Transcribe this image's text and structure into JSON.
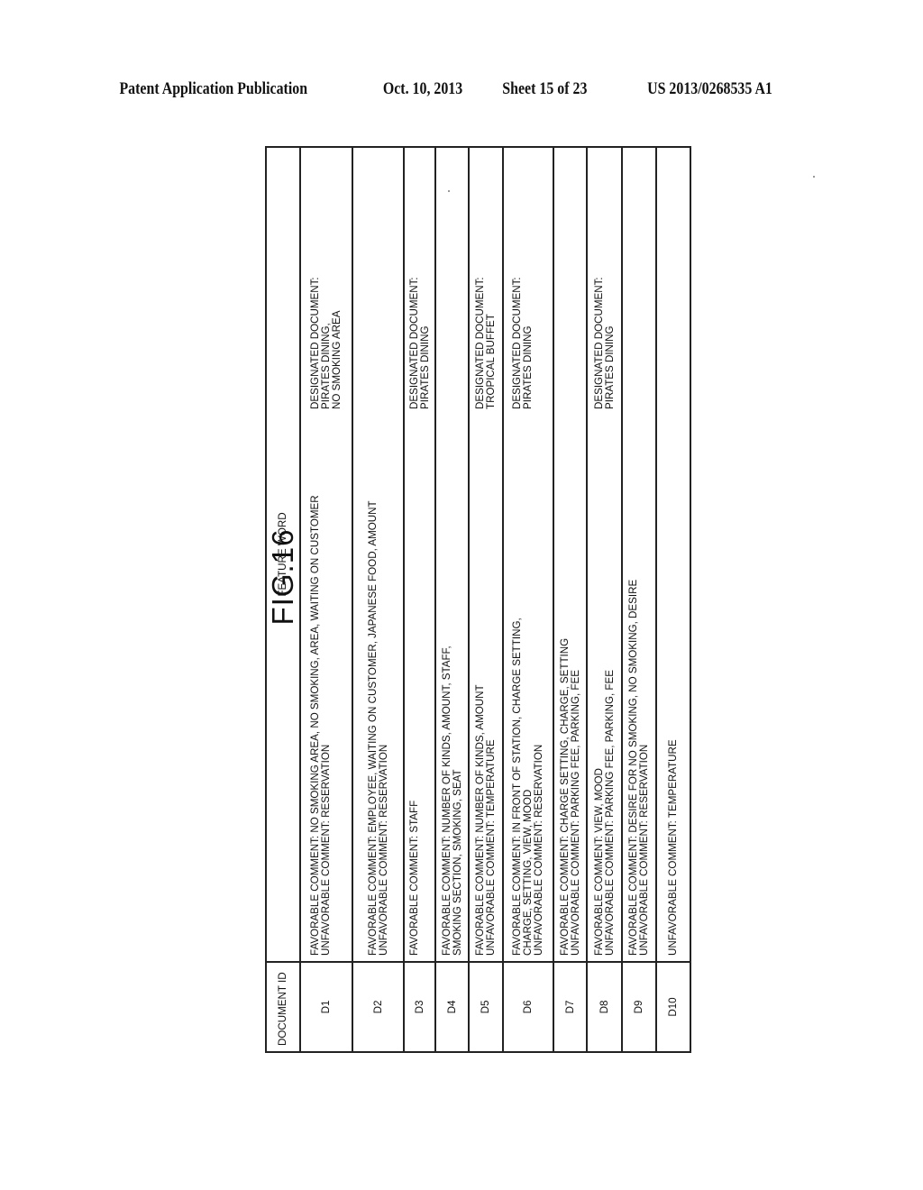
{
  "header": {
    "publication_type": "Patent Application Publication",
    "date": "Oct. 10, 2013",
    "sheet": "Sheet 15 of 23",
    "number": "US 2013/0268535 A1"
  },
  "figure": {
    "label": "FIG.16",
    "orientation": "rotated 90 degrees counter-clockwise"
  },
  "table": {
    "columns": [
      "DOCUMENT ID",
      "FEATURE WORD"
    ],
    "rows": [
      {
        "id": "D1",
        "feature_lines": [
          "FAVORABLE COMMENT: NO SMOKING AREA, NO SMOKING, AREA, WAITING ON CUSTOMER",
          "UNFAVORABLE COMMENT: RESERVATION"
        ],
        "designated_lines": [
          "DESIGNATED DOCUMENT:",
          "PIRATES DINING,",
          "NO SMOKING AREA"
        ]
      },
      {
        "id": "D2",
        "feature_lines": [
          "FAVORABLE COMMENT: EMPLOYEE, WAITING ON CUSTOMER, JAPANESE FOOD, AMOUNT",
          "UNFAVORABLE COMMENT: RESERVATION"
        ],
        "designated_lines": []
      },
      {
        "id": "D3",
        "feature_lines": [
          "FAVORABLE COMMENT: STAFF"
        ],
        "designated_lines": [
          "DESIGNATED DOCUMENT:",
          "PIRATES DINING"
        ]
      },
      {
        "id": "D4",
        "feature_lines": [
          "FAVORABLE COMMENT: NUMBER OF KINDS, AMOUNT, STAFF,",
          "SMOKING SECTION, SMOKING, SEAT"
        ],
        "designated_lines": []
      },
      {
        "id": "D5",
        "feature_lines": [
          "FAVORABLE COMMENT: NUMBER OF KINDS, AMOUNT",
          "UNFAVORABLE COMMENT: TEMPERATURE"
        ],
        "designated_lines": [
          "DESIGNATED DOCUMENT:",
          "TROPICAL BUFFET"
        ]
      },
      {
        "id": "D6",
        "feature_lines": [
          "FAVORABLE COMMENT: IN FRONT OF STATION, CHARGE SETTING,",
          "CHARGE, SETTING, VIEW, MOOD",
          "UNFAVORABLE COMMENT: RESERVATION"
        ],
        "designated_lines": [
          "DESIGNATED DOCUMENT:",
          "PIRATES DINING"
        ]
      },
      {
        "id": "D7",
        "feature_lines": [
          "FAVORABLE COMMENT: CHARGE SETTING, CHARGE, SETTING",
          "UNFAVORABLE COMMENT: PARKING FEE, PARKING, FEE"
        ],
        "designated_lines": []
      },
      {
        "id": "D8",
        "feature_lines": [
          "FAVORABLE COMMENT: VIEW, MOOD",
          "UNFAVORABLE COMMENT: PARKING FEE, PARKING, FEE"
        ],
        "designated_lines": [
          "DESIGNATED DOCUMENT:",
          "PIRATES DINING"
        ]
      },
      {
        "id": "D9",
        "feature_lines": [
          "FAVORABLE COMMENT: DESIRE FOR NO SMOKING, NO SMOKING, DESIRE",
          "UNFAVORABLE COMMENT: RESERVATION"
        ],
        "designated_lines": []
      },
      {
        "id": "D10",
        "feature_lines": [
          "UNFAVORABLE COMMENT: TEMPERATURE"
        ],
        "designated_lines": []
      }
    ]
  }
}
